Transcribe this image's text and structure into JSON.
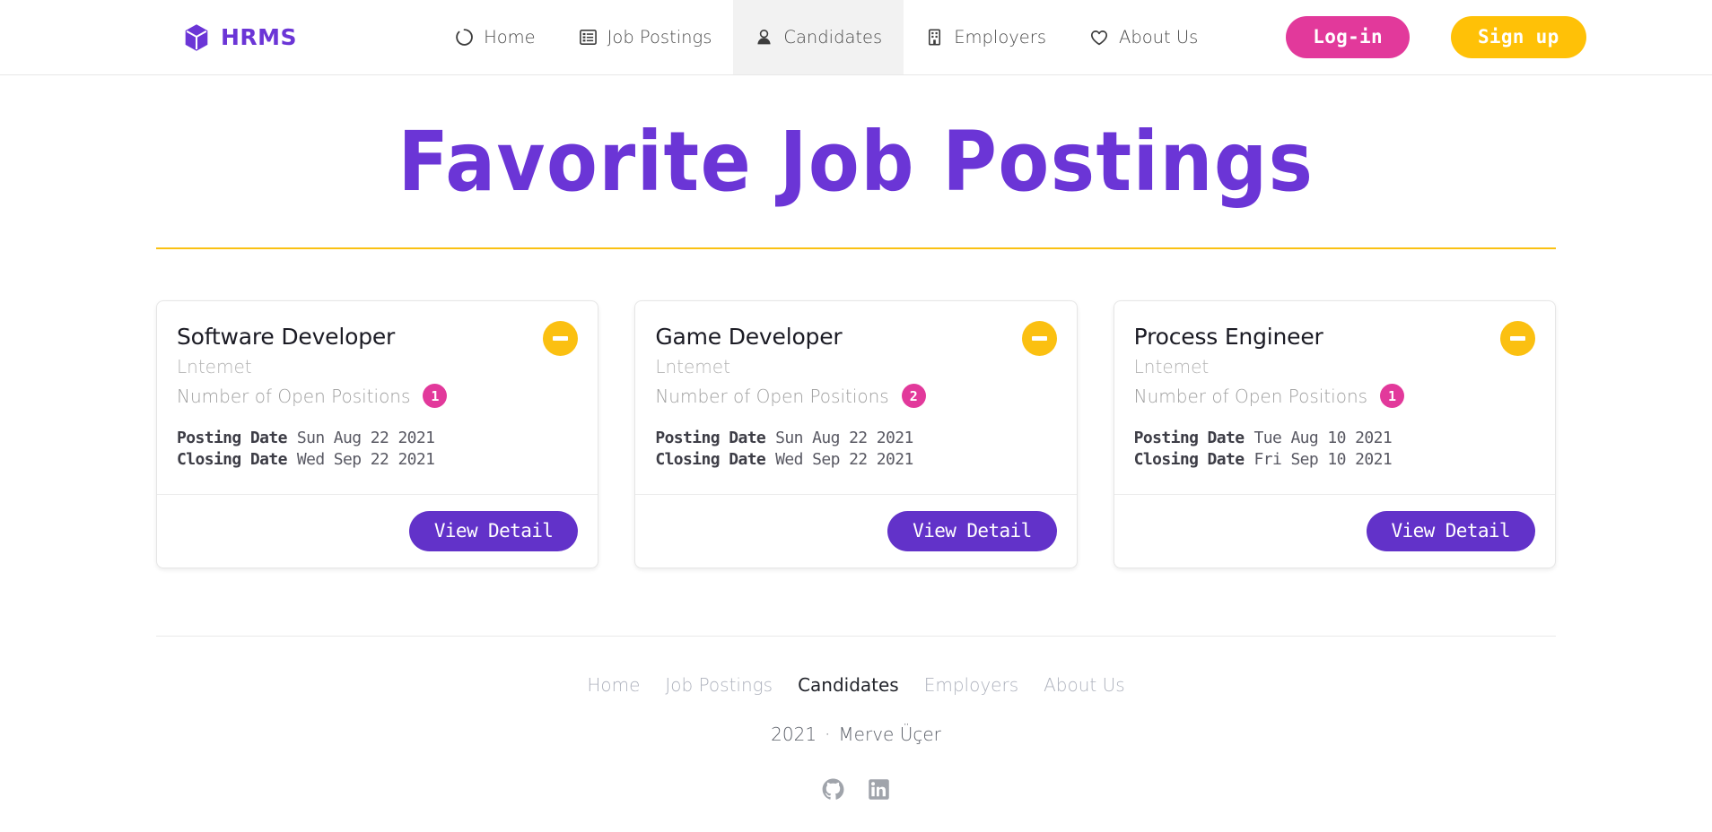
{
  "navbar": {
    "brand": {
      "label": "HRMS",
      "icon": "cube-icon",
      "color": "#6b35d6"
    },
    "links": [
      {
        "label": "Home",
        "icon": "circle-dashed-icon",
        "active": false
      },
      {
        "label": "Job Postings",
        "icon": "list-icon",
        "active": false
      },
      {
        "label": "Candidates",
        "icon": "user-icon",
        "active": true
      },
      {
        "label": "Employers",
        "icon": "building-icon",
        "active": false
      },
      {
        "label": "About Us",
        "icon": "heart-icon",
        "active": false
      }
    ],
    "login_label": "Log-in",
    "signup_label": "Sign up",
    "login_color": "#e2399b",
    "signup_color": "#ffc107"
  },
  "page": {
    "title": "Favorite Job Postings",
    "title_color": "#6b35d6",
    "rule_color": "#fac113"
  },
  "cards": [
    {
      "title": "Software Developer",
      "employer": "Lntemet",
      "positions_label": "Number of Open Positions",
      "positions_count": "1",
      "posting_date_label": "Posting Date",
      "posting_date_value": "Sun Aug 22 2021",
      "closing_date_label": "Closing Date",
      "closing_date_value": "Wed Sep 22 2021",
      "detail_label": "View Detail",
      "remove_icon": "minus-icon"
    },
    {
      "title": "Game Developer",
      "employer": "Lntemet",
      "positions_label": "Number of Open Positions",
      "positions_count": "2",
      "posting_date_label": "Posting Date",
      "posting_date_value": "Sun Aug 22 2021",
      "closing_date_label": "Closing Date",
      "closing_date_value": "Wed Sep 22 2021",
      "detail_label": "View Detail",
      "remove_icon": "minus-icon"
    },
    {
      "title": "Process Engineer",
      "employer": "Lntemet",
      "positions_label": "Number of Open Positions",
      "positions_count": "1",
      "posting_date_label": "Posting Date",
      "posting_date_value": "Tue Aug 10 2021",
      "closing_date_label": "Closing Date",
      "closing_date_value": "Fri Sep 10 2021",
      "detail_label": "View Detail",
      "remove_icon": "minus-icon"
    }
  ],
  "footer": {
    "links": [
      {
        "label": "Home",
        "active": false
      },
      {
        "label": "Job Postings",
        "active": false
      },
      {
        "label": "Candidates",
        "active": true
      },
      {
        "label": "Employers",
        "active": false
      },
      {
        "label": "About Us",
        "active": false
      }
    ],
    "year": "2021",
    "separator": "·",
    "author": "Merve Üçer",
    "social": [
      {
        "icon": "github-icon"
      },
      {
        "icon": "linkedin-icon"
      }
    ]
  }
}
